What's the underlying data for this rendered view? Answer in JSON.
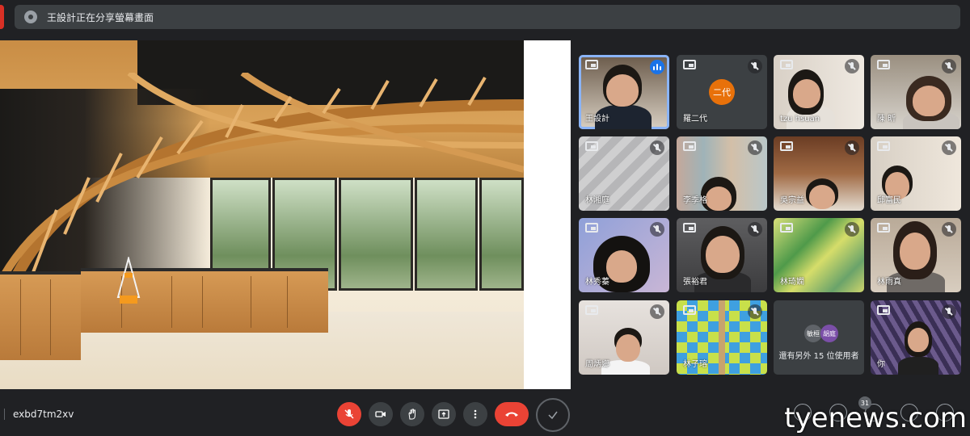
{
  "banner": {
    "text": "王設計正在分享螢幕畫面"
  },
  "participants": [
    {
      "name": "王設計"
    },
    {
      "name": "羅二代",
      "avatar": "二代"
    },
    {
      "name": "tzu hsuan"
    },
    {
      "name": "陳 昕"
    },
    {
      "name": "林湘庭"
    },
    {
      "name": "李季格"
    },
    {
      "name": "吳宗益"
    },
    {
      "name": "邱富民"
    },
    {
      "name": "林秀蓁"
    },
    {
      "name": "張裕君"
    },
    {
      "name": "林琦嫻"
    },
    {
      "name": "林雨真"
    },
    {
      "name": "周炳鄉"
    },
    {
      "name": "林子瑢"
    },
    {
      "name": "還有另外 15 位使用者",
      "avatars": [
        "敏桓",
        "胡庭"
      ]
    },
    {
      "name": "你"
    }
  ],
  "toolbar": {
    "meeting_code": "exbd7tm2xv",
    "participants_count": "31"
  },
  "watermark": "tyenews.com",
  "colors": {
    "accent": "#8ab4f8",
    "danger": "#ea4335",
    "avatar_orange": "#e8710a"
  },
  "icons": [
    "screen-share-icon",
    "mic-off-icon",
    "camera-icon",
    "raise-hand-icon",
    "present-icon",
    "more-vert-icon",
    "end-call-icon"
  ]
}
